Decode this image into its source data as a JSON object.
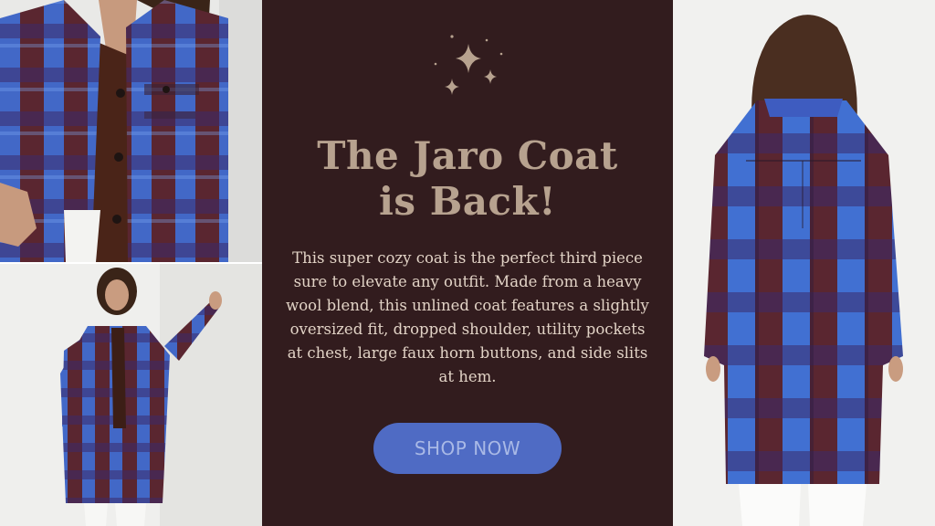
{
  "promo": {
    "headline_line1": "The Jaro Coat",
    "headline_line2": "is Back!",
    "body": "This super cozy coat is the perfect third piece sure to elevate any outfit. Made from a heavy wool blend, this unlined coat features a slightly oversized fit, dropped shoulder, utility pockets at chest, large faux horn buttons, and side slits at hem.",
    "cta_label": "SHOP NOW",
    "decoration_icon": "sparkles-icon"
  },
  "colors": {
    "panel_background": "#321c1e",
    "headline": "#b7a28f",
    "body_text": "#e2d3c6",
    "button_background": "#4f6bc4",
    "button_text": "#a9b9e6",
    "plaid_blue": "#4880e6",
    "plaid_burgundy": "#642424"
  }
}
